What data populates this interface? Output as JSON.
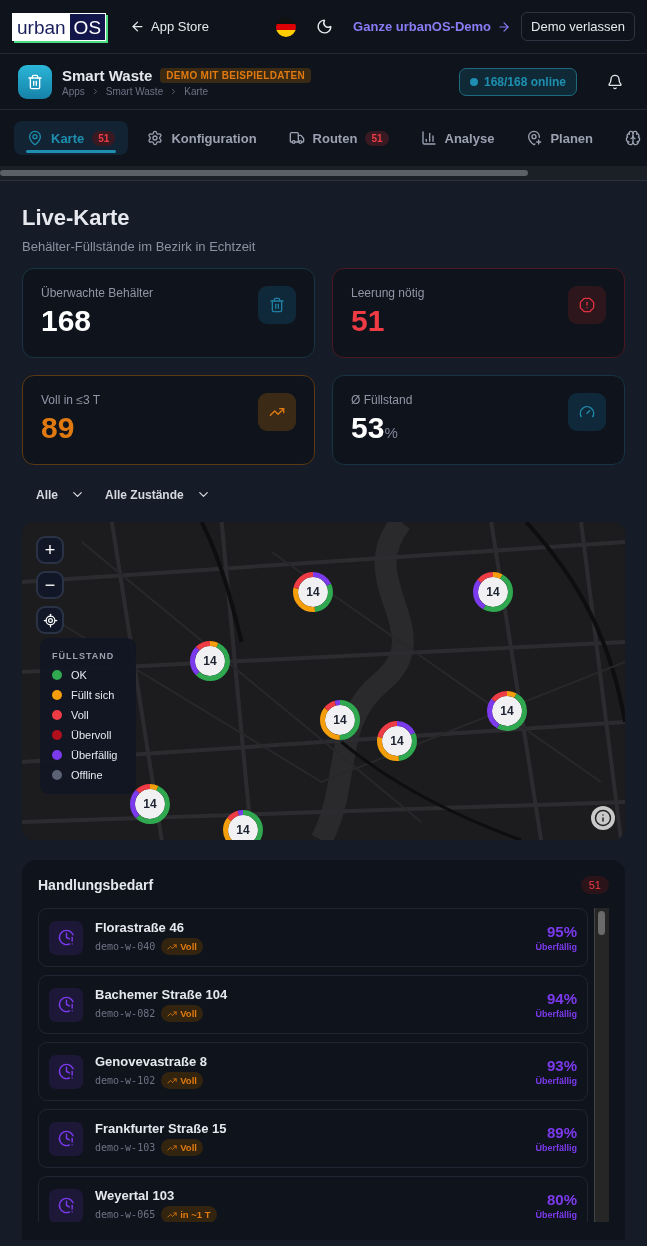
{
  "topbar": {
    "logo": {
      "left": "urban",
      "right": "OS"
    },
    "back_link": "App Store",
    "demo_link": "Ganze urbanOS-Demo",
    "exit_button": "Demo verlassen"
  },
  "app_header": {
    "title": "Smart Waste",
    "badge": "DEMO MIT BEISPIELDATEN",
    "breadcrumb": [
      "Apps",
      "Smart Waste",
      "Karte"
    ],
    "status": "168/168 online"
  },
  "tabs": [
    {
      "label": "Karte",
      "badge": "51",
      "selected": true
    },
    {
      "label": "Konfiguration",
      "selected": false
    },
    {
      "label": "Routen",
      "badge": "51",
      "selected": false
    },
    {
      "label": "Analyse",
      "selected": false
    },
    {
      "label": "Planen",
      "selected": false
    },
    {
      "selected": false
    }
  ],
  "page": {
    "title": "Live-Karte",
    "subtitle": "Behälter-Füllstände im Bezirk in Echtzeit"
  },
  "stats": [
    {
      "kind": "neutral",
      "label": "Überwachte Behälter",
      "value": "168"
    },
    {
      "kind": "danger",
      "label": "Leerung nötig",
      "value": "51"
    },
    {
      "kind": "warning",
      "label": "Voll in ≤3 T",
      "value": "89"
    },
    {
      "kind": "info",
      "label": "Ø Füllstand",
      "value": "53",
      "unit": "%"
    }
  ],
  "filters": [
    {
      "value": "Alle"
    },
    {
      "value": "Alle Zustände"
    }
  ],
  "map": {
    "zoom_controls": [
      "+",
      "−"
    ],
    "legend": {
      "title": "FÜLLSTAND",
      "items": [
        {
          "label": "OK",
          "color": "#2fa84f"
        },
        {
          "label": "Füllt sich",
          "color": "#f59e0b"
        },
        {
          "label": "Voll",
          "color": "#ef3b44"
        },
        {
          "label": "Übervoll",
          "color": "#b0101c"
        },
        {
          "label": "Überfällig",
          "color": "#7c3aed"
        },
        {
          "label": "Offline",
          "color": "#5b6273"
        }
      ]
    },
    "clusters": [
      {
        "label": "14"
      },
      {
        "label": "14"
      },
      {
        "label": "14"
      },
      {
        "label": "14"
      },
      {
        "label": "14"
      },
      {
        "label": "14"
      },
      {
        "label": "14"
      },
      {
        "label": "14"
      }
    ]
  },
  "action_list": {
    "title": "Handlungsbedarf",
    "count": "51",
    "rows": [
      {
        "name": "Florastraße 46",
        "id": "demo-w-040",
        "tag": "Voll",
        "percent": "95%",
        "status": "Überfällig"
      },
      {
        "name": "Bachemer Straße 104",
        "id": "demo-w-082",
        "tag": "Voll",
        "percent": "94%",
        "status": "Überfällig"
      },
      {
        "name": "Genovevastraße 8",
        "id": "demo-w-102",
        "tag": "Voll",
        "percent": "93%",
        "status": "Überfällig"
      },
      {
        "name": "Frankfurter Straße 15",
        "id": "demo-w-103",
        "tag": "Voll",
        "percent": "89%",
        "status": "Überfällig"
      },
      {
        "name": "Weyertal 103",
        "id": "demo-w-065",
        "tag": "in ~1 T",
        "percent": "80%",
        "status": "Überfällig"
      }
    ]
  }
}
